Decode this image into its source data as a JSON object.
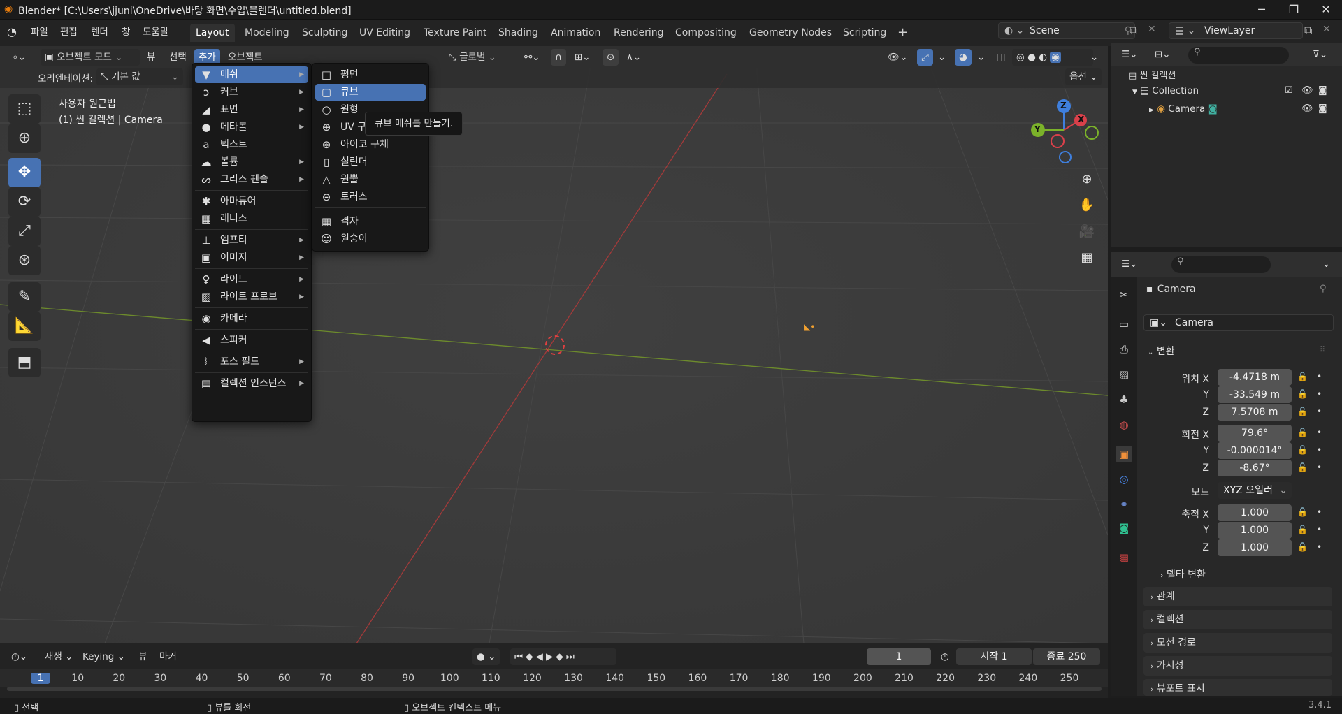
{
  "titlebar": {
    "title": "Blender* [C:\\Users\\jjuni\\OneDrive\\바탕 화면\\수업\\블렌더\\untitled.blend]",
    "minimize": "─",
    "maximize": "❐",
    "close": "✕"
  },
  "menubar": [
    "파일",
    "편집",
    "렌더",
    "창",
    "도움말"
  ],
  "workspaces": [
    "Layout",
    "Modeling",
    "Sculpting",
    "UV Editing",
    "Texture Paint",
    "Shading",
    "Animation",
    "Rendering",
    "Compositing",
    "Geometry Nodes",
    "Scripting",
    "+"
  ],
  "scene": {
    "label": "Scene",
    "viewlayer": "ViewLayer"
  },
  "viewport_header": {
    "mode": "오브젝트 모드",
    "items": [
      "뷰",
      "선택",
      "추가",
      "오브젝트"
    ],
    "transform": "글로벌",
    "options": "옵션",
    "orientation_label": "오리엔테이션:",
    "orientation_value": "기본 값"
  },
  "overlay_text": {
    "line1": "사용자 원근법",
    "line2": "(1) 씬 컬렉션 | Camera"
  },
  "add_menu": [
    {
      "label": "메쉬",
      "icon": "▼",
      "sub": true,
      "highlight": true
    },
    {
      "label": "커브",
      "icon": "ↄ",
      "sub": true
    },
    {
      "label": "표면",
      "icon": "◢",
      "sub": true
    },
    {
      "label": "메타볼",
      "icon": "●",
      "sub": true
    },
    {
      "label": "텍스트",
      "icon": "a",
      "sub": false
    },
    {
      "label": "볼륨",
      "icon": "☁",
      "sub": true
    },
    {
      "label": "그리스 펜슬",
      "icon": "ᔕ",
      "sub": true
    },
    {
      "label": "아마튜어",
      "icon": "✱",
      "sub": false
    },
    {
      "label": "래티스",
      "icon": "▦",
      "sub": false
    },
    {
      "label": "엠프티",
      "icon": "⊥",
      "sub": true
    },
    {
      "label": "이미지",
      "icon": "▣",
      "sub": true
    },
    {
      "label": "라이트",
      "icon": "♀",
      "sub": true
    },
    {
      "label": "라이트 프로브",
      "icon": "▨",
      "sub": true
    },
    {
      "label": "카메라",
      "icon": "◉",
      "sub": false
    },
    {
      "label": "스피커",
      "icon": "◀",
      "sub": false
    },
    {
      "label": "포스 필드",
      "icon": "⦚",
      "sub": true
    },
    {
      "label": "컬렉션 인스턴스",
      "icon": "▤",
      "sub": true
    }
  ],
  "mesh_menu": [
    {
      "label": "평면",
      "icon": "□"
    },
    {
      "label": "큐브",
      "icon": "▢",
      "highlight": true
    },
    {
      "label": "원형",
      "icon": "○"
    },
    {
      "label": "UV 구",
      "icon": "⊕"
    },
    {
      "label": "아이코 구체",
      "icon": "⊛"
    },
    {
      "label": "실린더",
      "icon": "▯"
    },
    {
      "label": "원뿔",
      "icon": "△"
    },
    {
      "label": "토러스",
      "icon": "⊝"
    },
    {
      "label": "격자",
      "icon": "▦"
    },
    {
      "label": "원숭이",
      "icon": "☺"
    }
  ],
  "tooltip": "큐브 메쉬를 만들기.",
  "gizmo": {
    "z": "Z",
    "x": "X",
    "y": "Y"
  },
  "outliner": {
    "scene_collection": "씬 컬렉션",
    "collection": "Collection",
    "camera": "Camera"
  },
  "properties": {
    "object_name": "Camera",
    "datablock": "Camera",
    "transform_label": "변환",
    "location": {
      "label": "위치 X",
      "x": "-4.4718 m",
      "y": "-33.549 m",
      "z": "7.5708 m"
    },
    "rotation": {
      "label": "회전 X",
      "x": "79.6°",
      "y": "-0.000014°",
      "z": "-8.67°"
    },
    "mode_label": "모드",
    "mode_value": "XYZ 오일러",
    "scale": {
      "label": "축적 X",
      "x": "1.000",
      "y": "1.000",
      "z": "1.000"
    },
    "axis_y": "Y",
    "axis_z": "Z",
    "delta": "델타 변환",
    "sections": [
      "관계",
      "컬렉션",
      "모션 경로",
      "가시성",
      "뷰포트 표시"
    ]
  },
  "timeline": {
    "play": "재생",
    "keying": "Keying",
    "view": "뷰",
    "marker": "마커",
    "current": "1",
    "start_label": "시작",
    "start": "1",
    "end_label": "종료",
    "end": "250",
    "ticks": [
      "1",
      "10",
      "20",
      "30",
      "40",
      "50",
      "60",
      "70",
      "80",
      "90",
      "100",
      "110",
      "120",
      "130",
      "140",
      "150",
      "160",
      "170",
      "180",
      "190",
      "200",
      "210",
      "220",
      "230",
      "240",
      "250"
    ]
  },
  "statusbar": {
    "select": "선택",
    "rotate": "뷰를 회전",
    "context": "오브젝트 컨텍스트 메뉴",
    "version": "3.4.1"
  }
}
